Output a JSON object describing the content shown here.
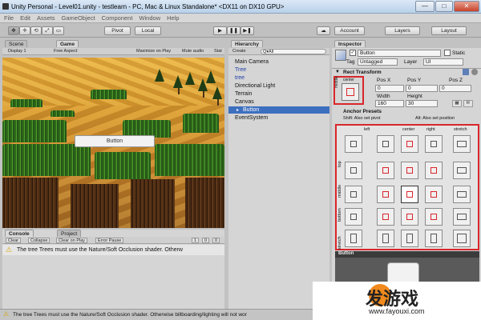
{
  "window": {
    "title": "Unity Personal - Level01.unity - testlearn - PC, Mac & Linux Standalone* <DX11 on DX10 GPU>",
    "minimize": "—",
    "maximize": "□",
    "close": "✕"
  },
  "menu": [
    "File",
    "Edit",
    "Assets",
    "GameObject",
    "Component",
    "Window",
    "Help"
  ],
  "toolbar": {
    "tools": [
      "✥",
      "✛",
      "⟲",
      "⤢",
      "▭"
    ],
    "pivot": "Pivot",
    "local": "Local",
    "play": "▶",
    "pause": "❚❚",
    "step": "▶❚",
    "account": "Account",
    "layers": "Layers",
    "layout": "Layout"
  },
  "left_tabs": {
    "scene": "Scene",
    "game": "Game"
  },
  "game_bar": {
    "display": "Display 1",
    "aspect": "Free Aspect",
    "maximize": "Maximize on Play",
    "mute": "Mute audio",
    "stats": "Stat"
  },
  "game_view": {
    "button_label": "Button"
  },
  "hierarchy": {
    "tab": "Hierarchy",
    "create": "Create",
    "search_placeholder": "Q▾All",
    "items": [
      {
        "label": "Main Camera"
      },
      {
        "label": "Tree"
      },
      {
        "label": "tree"
      },
      {
        "label": "Directional Light"
      },
      {
        "label": "Terrain"
      },
      {
        "label": "Canvas"
      },
      {
        "label": "Button"
      },
      {
        "label": "EventSystem"
      }
    ]
  },
  "inspector": {
    "tab": "Inspector",
    "name": "Button",
    "static": "Static",
    "tag_label": "Tag",
    "tag": "Untagged",
    "layer_label": "Layer",
    "layer": "UI",
    "rect_transform": "Rect Transform",
    "anchor_h": "center",
    "anchor_v": "middle",
    "pos_x_label": "Pos X",
    "pos_y_label": "Pos Y",
    "pos_z_label": "Pos Z",
    "pos_x": "0",
    "pos_y": "0",
    "pos_z": "0",
    "width_label": "Width",
    "height_label": "Height",
    "width": "160",
    "height": "30",
    "r_button": "R",
    "anchor_presets": "Anchor Presets",
    "shift_hint": "Shift: Also set pivot",
    "alt_hint": "Alt: Also set position",
    "cols": [
      "left",
      "center",
      "right",
      "stretch"
    ],
    "rows": [
      "top",
      "middle",
      "bottom",
      "stretch"
    ],
    "footer": "Button"
  },
  "console": {
    "tab": "Console",
    "project_tab": "Project",
    "clear": "Clear",
    "collapse": "Collapse",
    "clear_on_play": "Clear on Play",
    "error_pause": "Error Pause",
    "count_info": "1",
    "count_warn": "0",
    "count_err": "0",
    "message": "The tree Trees must use the Nature/Soft Occlusion shader. Otherw"
  },
  "status": {
    "message": "The tree Trees must use the Nature/Soft Occlusion shader. Otherwise billboarding/lighting will not wor"
  },
  "watermark": {
    "text": "发游戏",
    "url": "www.fayouxi.com"
  },
  "colors": {
    "selection": "#3d6fbf",
    "highlight_red": "#d9262a",
    "sky": "#e9a93a"
  }
}
